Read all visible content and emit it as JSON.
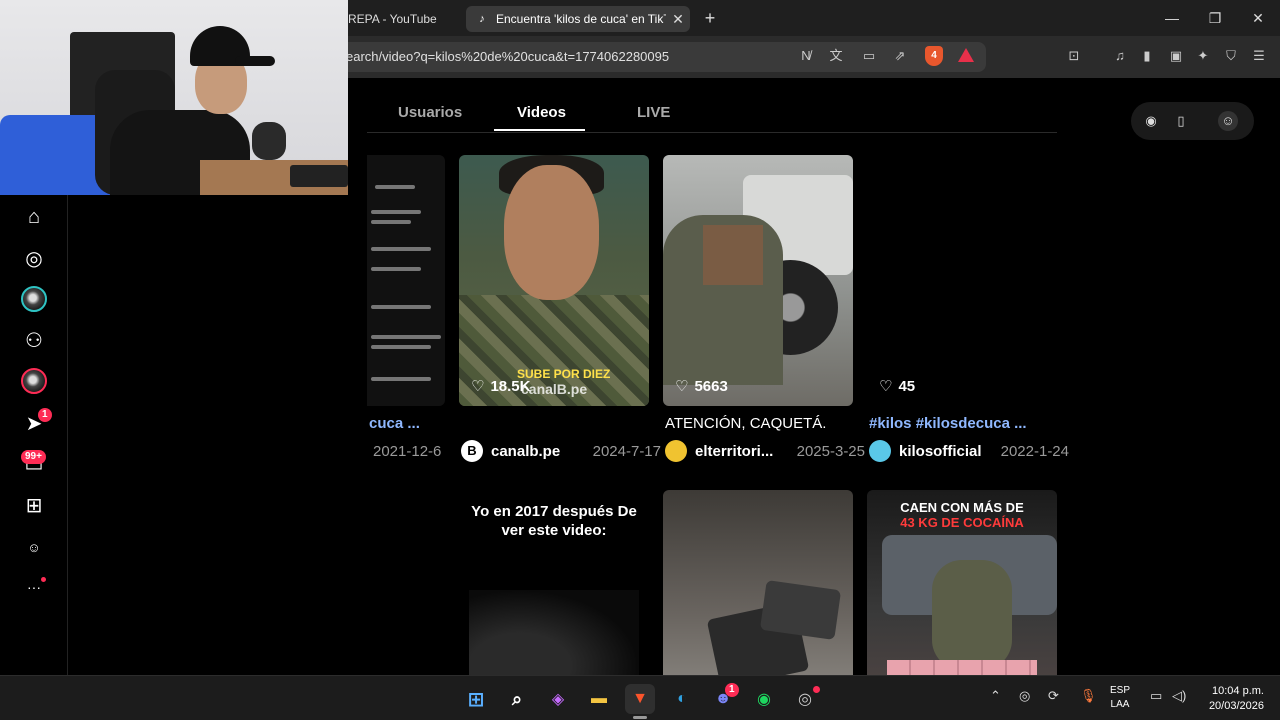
{
  "browser": {
    "tabs": [
      {
        "title": "REPA - YouTube"
      },
      {
        "title": "Encuentra 'kilos de cuca' en TikTo",
        "icon": "tiktok-icon"
      }
    ],
    "url": "earch/video?q=kilos%20de%20cuca&t=1774062280095",
    "shield_count": "4"
  },
  "leftnav": {
    "items": [
      {
        "name": "home-icon",
        "glyph": "⌂"
      },
      {
        "name": "explore-icon",
        "glyph": "◎"
      },
      {
        "name": "avatar-following",
        "glyph": ""
      },
      {
        "name": "friends-icon",
        "glyph": "⚇"
      },
      {
        "name": "avatar-live",
        "glyph": ""
      },
      {
        "name": "messages-icon",
        "glyph": "➤",
        "badge": "1"
      },
      {
        "name": "inbox-icon",
        "glyph": "▭",
        "badge": "99+"
      },
      {
        "name": "upload-icon",
        "glyph": "⊞"
      },
      {
        "name": "profile-icon",
        "glyph": "☺"
      },
      {
        "name": "more-icon",
        "glyph": "···"
      }
    ]
  },
  "search_tabs": [
    {
      "label": "Usuarios"
    },
    {
      "label": "Videos",
      "selected": true
    },
    {
      "label": "LIVE"
    }
  ],
  "videos": [
    {
      "likes": "",
      "desc": "cuca ...",
      "user": "",
      "date": "2021-12-6",
      "hashtag": true
    },
    {
      "likes": "18.5K",
      "desc": "",
      "user": "canalb.pe",
      "date": "2024-7-17",
      "avatar_color": "#ffffff",
      "avatar_letter": "B",
      "overlay_top": "SUBE POR DIEZ",
      "overlay_bottom": "canalB.pe"
    },
    {
      "likes": "5663",
      "desc": "ATENCIÓN, CAQUETÁ.",
      "user": "elterritori...",
      "date": "2025-3-25",
      "avatar_color": "#f0c330"
    },
    {
      "likes": "45",
      "desc": "#kilos #kilosdecuca ...",
      "user": "kilosofficial",
      "date": "2022-1-24",
      "avatar_color": "#5ac8e8",
      "hashtag": true
    },
    {
      "meme_text": "Yo en 2017 después De ver este video:"
    },
    {},
    {
      "title_line1": "CAEN CON MÁS DE",
      "title_line2": "43 KG DE COCAÍNA"
    }
  ],
  "taskbar": {
    "lang_line1": "ESP",
    "lang_line2": "LAA",
    "time": "10:04 p.m.",
    "date": "20/03/2026",
    "discord_badge": "1"
  },
  "colors": {
    "accent": "#fe2c55",
    "hashtag": "#8fb8ff"
  }
}
